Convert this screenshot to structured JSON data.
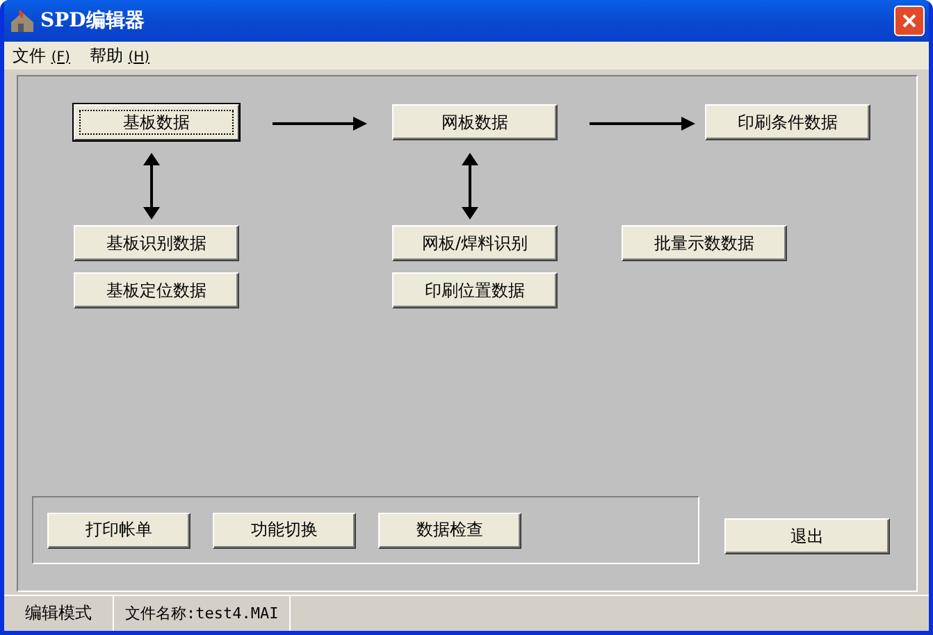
{
  "window": {
    "title": "SPD编辑器"
  },
  "menu": [
    {
      "label": "文件"
    },
    {
      "label": "帮助"
    }
  ],
  "menu_keys": [
    "(F)",
    "(H)"
  ],
  "diagram_buttons": [
    {
      "label": "基板数据",
      "focused": true
    },
    {
      "label": "网板数据",
      "focused": false
    },
    {
      "label": "印刷条件数据",
      "focused": false
    },
    {
      "label": "基板识别数据",
      "focused": false
    },
    {
      "label": "基板定位数据",
      "focused": false
    },
    {
      "label": "网板/焊料识别",
      "focused": false
    },
    {
      "label": "印刷位置数据",
      "focused": false
    },
    {
      "label": "批量示数数据",
      "focused": false
    }
  ],
  "tool_buttons": [
    "打印帐单",
    "功能切换",
    "数据检查"
  ],
  "exit_button": "退出",
  "status_bar": [
    "编辑模式",
    "文件名称:test4.MAI"
  ]
}
